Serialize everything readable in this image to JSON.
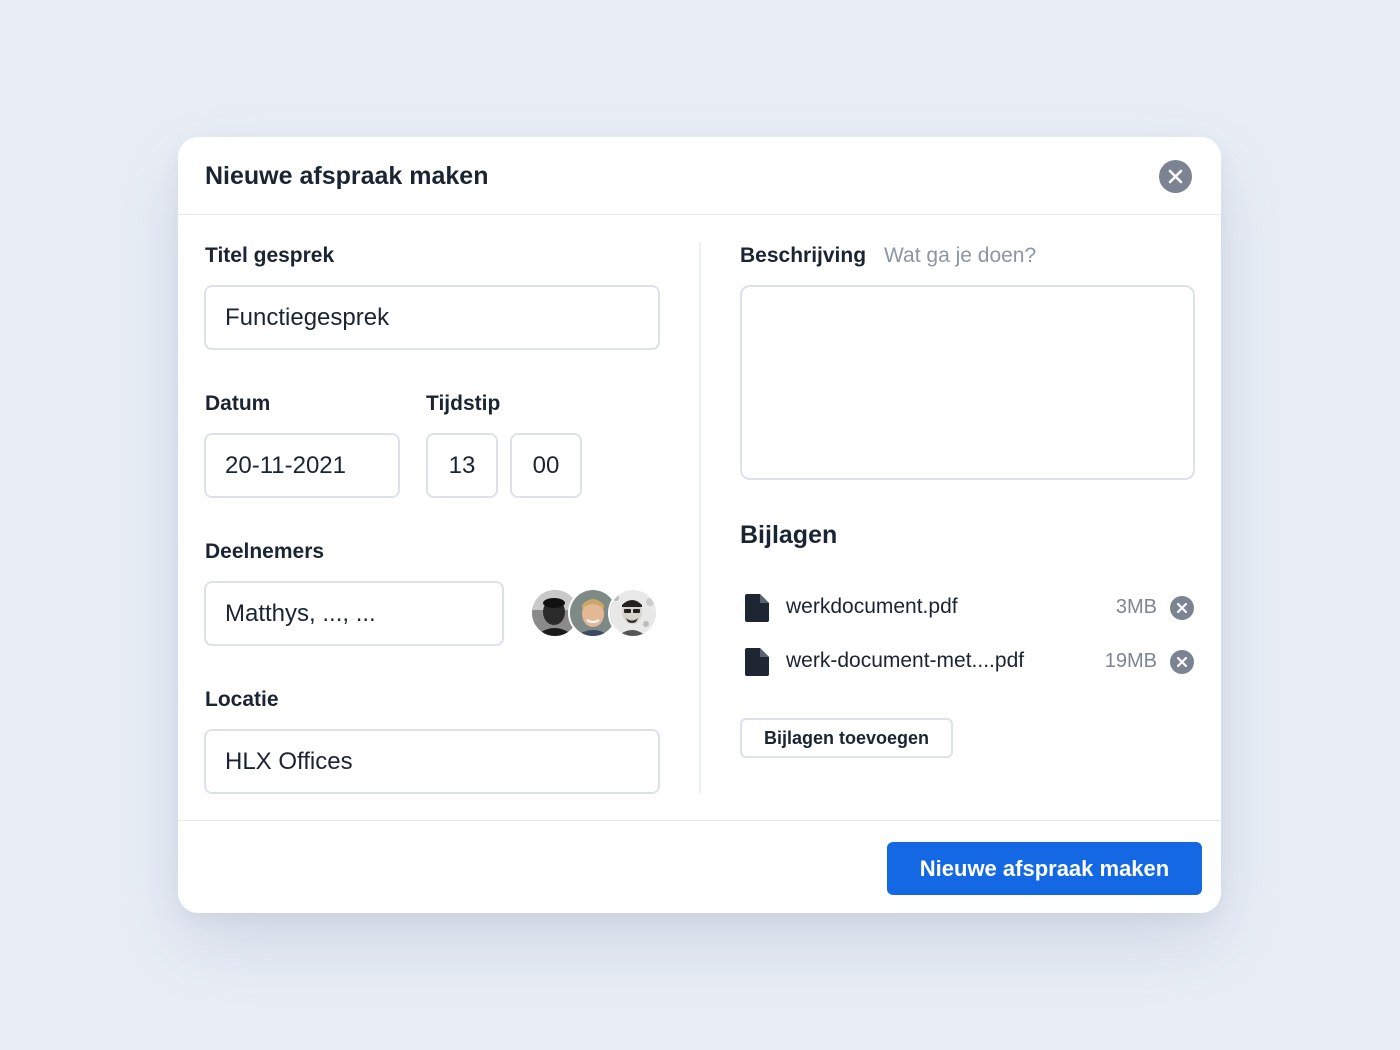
{
  "modal": {
    "title": "Nieuwe afspraak maken",
    "close_icon": "close-icon"
  },
  "form": {
    "title_label": "Titel gesprek",
    "title_value": "Functiegesprek",
    "date_label": "Datum",
    "date_value": "20-11-2021",
    "time_label": "Tijdstip",
    "time_hour": "13",
    "time_minute": "00",
    "participants_label": "Deelnemers",
    "participants_value": "Matthys, ..., ...",
    "location_label": "Locatie",
    "location_value": "HLX Offices",
    "description_label": "Beschrijving",
    "description_placeholder": "Wat ga je doen?",
    "description_value": ""
  },
  "participants": {
    "avatars": [
      "avatar-1",
      "avatar-2",
      "avatar-3"
    ]
  },
  "attachments": {
    "title": "Bijlagen",
    "files": [
      {
        "name": "werkdocument.pdf",
        "size": "3MB",
        "icon": "file-icon"
      },
      {
        "name": "werk-document-met....pdf",
        "size": "19MB",
        "icon": "file-icon"
      }
    ],
    "add_label": "Bijlagen toevoegen"
  },
  "footer": {
    "submit_label": "Nieuwe afspraak maken"
  },
  "colors": {
    "background": "#e9eef6",
    "primary": "#1468e3",
    "border": "#dde1ea",
    "muted_text": "#8d94a3",
    "icon_grey": "#7c8393"
  }
}
